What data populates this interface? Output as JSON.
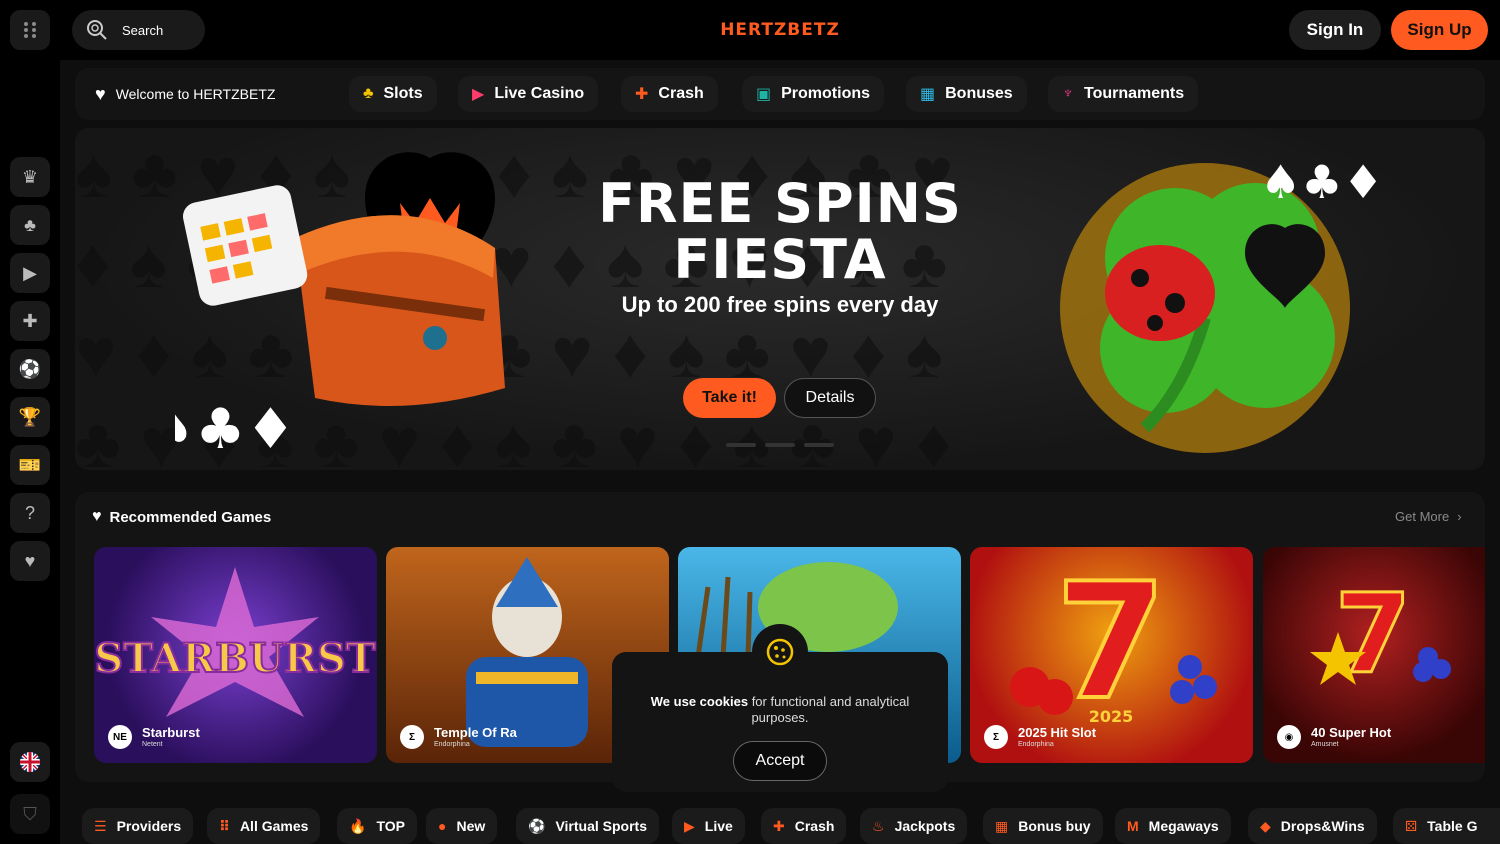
{
  "header": {
    "search_label": "Search",
    "logo": "HERTZBETZ",
    "sign_in": "Sign In",
    "sign_up": "Sign Up"
  },
  "sidebar": {
    "items": [
      "crown-icon",
      "cherries-icon",
      "play-screen-icon",
      "crash-icon",
      "soccer-ball-icon",
      "trophy-icon",
      "ticket-icon",
      "help-icon",
      "heart-icon"
    ],
    "language": "uk-flag-icon",
    "bottom": "shield-icon"
  },
  "nav": {
    "welcome": "Welcome to HERTZBETZ",
    "items": [
      {
        "label": "Slots",
        "icon": "cherries-icon"
      },
      {
        "label": "Live Casino",
        "icon": "play-screen-icon"
      },
      {
        "label": "Crash",
        "icon": "crash-icon"
      },
      {
        "label": "Promotions",
        "icon": "ticket-icon"
      },
      {
        "label": "Bonuses",
        "icon": "gift-box-icon"
      },
      {
        "label": "Tournaments",
        "icon": "trophy-icon"
      }
    ]
  },
  "hero": {
    "title_line1": "FREE SPINS",
    "title_line2": "FIESTA",
    "subtitle": "Up to 200 free spins every day",
    "cta": "Take it!",
    "details": "Details"
  },
  "recommended": {
    "title": "Recommended Games",
    "get_more": "Get More",
    "games": [
      {
        "name": "Starburst",
        "provider": "Netent",
        "badge": "NE"
      },
      {
        "name": "Temple Of Ra",
        "provider": "Endorphina",
        "badge": "Σ"
      },
      {
        "name": "",
        "provider": "",
        "badge": ""
      },
      {
        "name": "2025 Hit Slot",
        "provider": "Endorphina",
        "badge": "Σ"
      },
      {
        "name": "40 Super Hot",
        "provider": "Amusnet",
        "badge": "◉"
      }
    ]
  },
  "cookie": {
    "bold": "We use cookies",
    "rest": " for functional and analytical purposes.",
    "accept": "Accept"
  },
  "categories": [
    "Providers",
    "All Games",
    "TOP",
    "New",
    "Virtual Sports",
    "Live",
    "Crash",
    "Jackpots",
    "Bonus buy",
    "Megaways",
    "Drops&Wins",
    "Table G"
  ],
  "colors": {
    "accent": "#ff5a1f",
    "background": "#0b0b0b",
    "panel": "#141414"
  }
}
